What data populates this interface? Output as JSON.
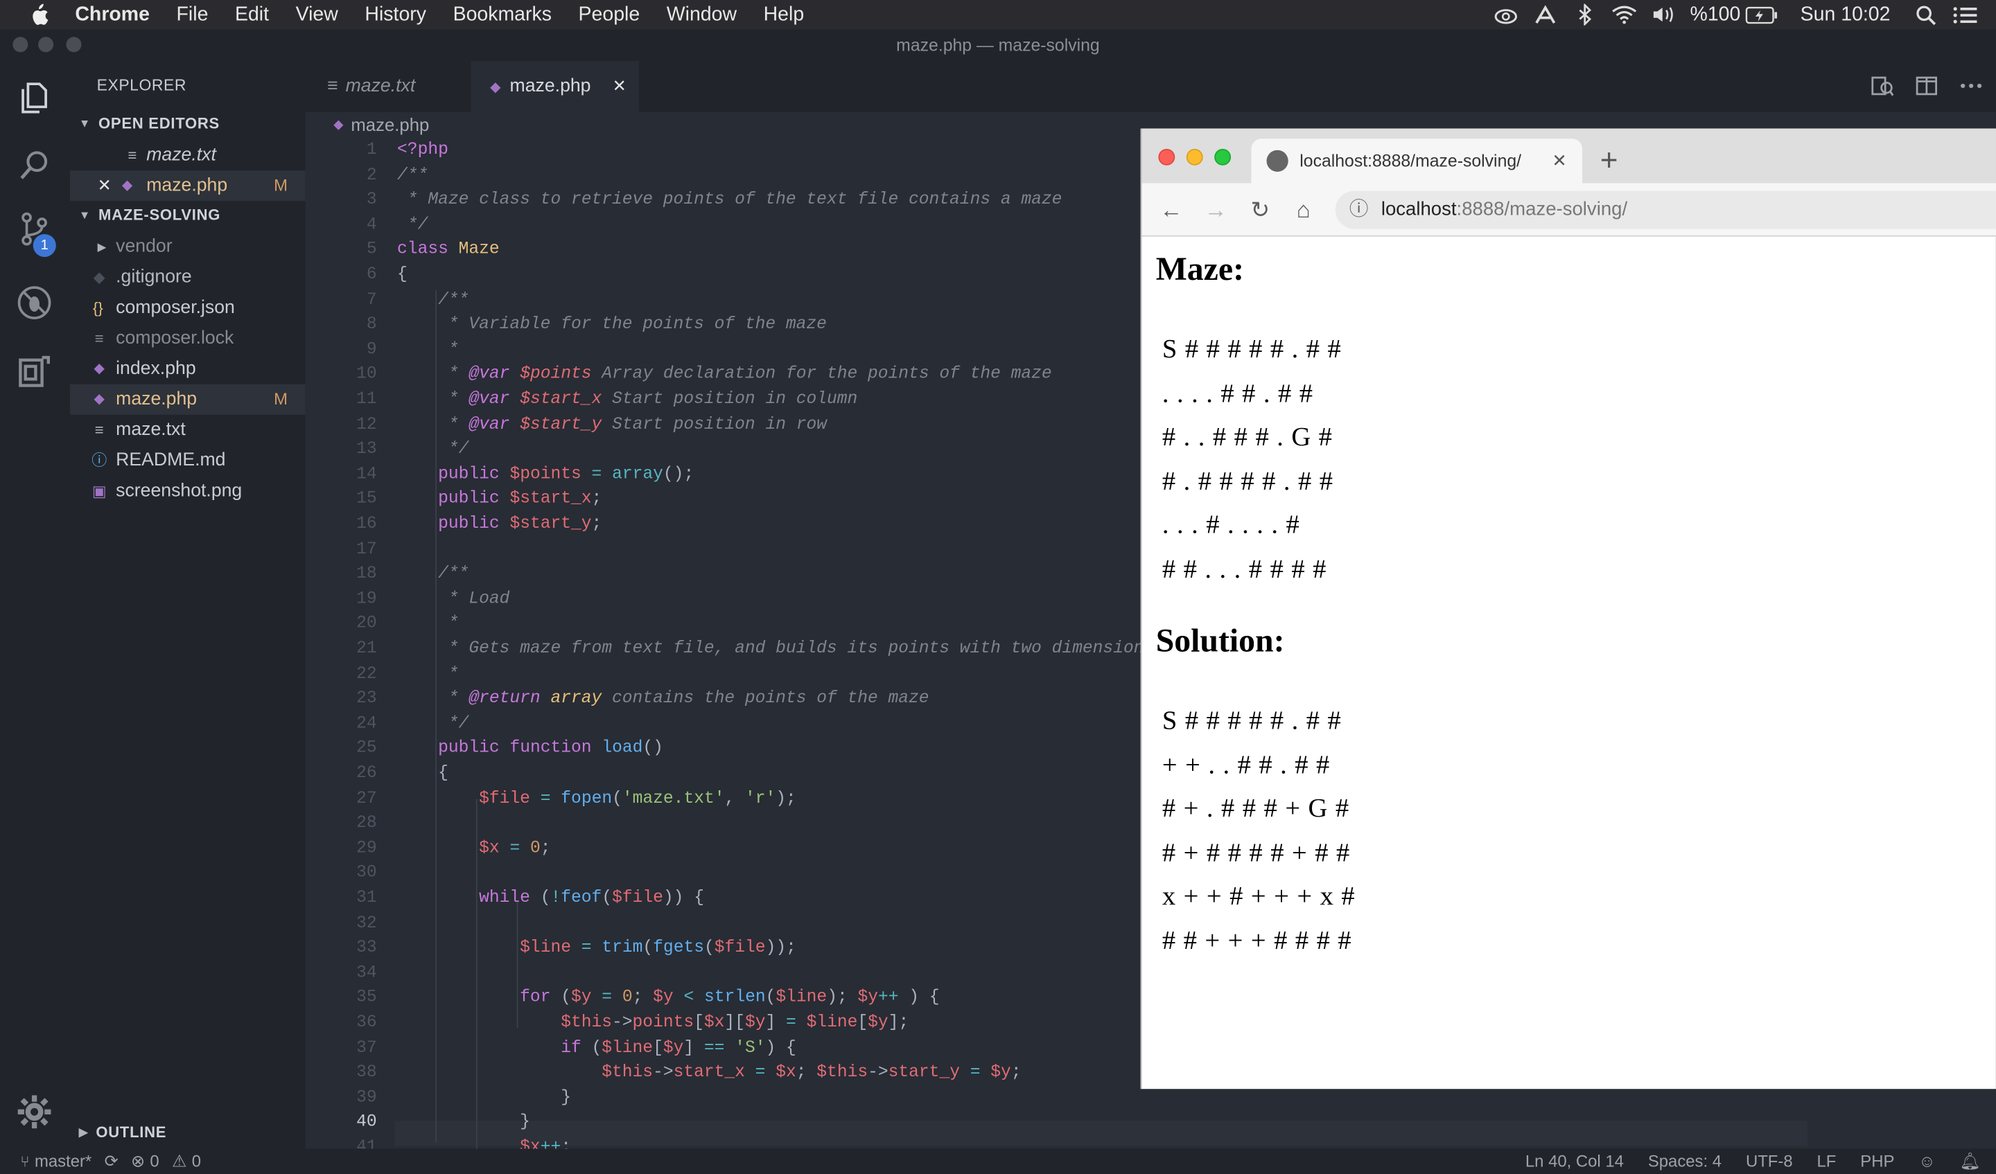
{
  "menubar": {
    "items": [
      "Chrome",
      "File",
      "Edit",
      "View",
      "History",
      "Bookmarks",
      "People",
      "Window",
      "Help"
    ],
    "battery": "%100",
    "clock": "Sun 10:02"
  },
  "window": {
    "title": "maze.php — maze-solving"
  },
  "activity": {
    "scm_badge": "1"
  },
  "sidebar": {
    "header": "EXPLORER",
    "open_editors_label": "OPEN EDITORS",
    "open_editors": [
      {
        "name": "maze.txt",
        "icon": "text-file-icon"
      },
      {
        "name": "maze.php",
        "icon": "php-file-icon",
        "status": "M"
      }
    ],
    "folder_label": "MAZE-SOLVING",
    "files": [
      {
        "name": "vendor",
        "icon": "folder-chevron-icon"
      },
      {
        "name": ".gitignore",
        "icon": "git-icon"
      },
      {
        "name": "composer.json",
        "icon": "json-icon"
      },
      {
        "name": "composer.lock",
        "icon": "text-file-icon"
      },
      {
        "name": "index.php",
        "icon": "php-file-icon"
      },
      {
        "name": "maze.php",
        "icon": "php-file-icon",
        "status": "M"
      },
      {
        "name": "maze.txt",
        "icon": "text-file-icon"
      },
      {
        "name": "README.md",
        "icon": "info-icon"
      },
      {
        "name": "screenshot.png",
        "icon": "image-icon"
      }
    ],
    "outline_label": "OUTLINE"
  },
  "tabs": [
    {
      "name": "maze.txt",
      "active": false
    },
    {
      "name": "maze.php",
      "active": true
    }
  ],
  "breadcrumb": "maze.php",
  "code_lines": [
    "<?php",
    "/**",
    " * Maze class to retrieve points of the text file contains a maze",
    " */",
    "class Maze",
    "{",
    "    /**",
    "     * Variable for the points of the maze",
    "     *",
    "     * @var $points Array declaration for the points of the maze",
    "     * @var $start_x Start position in column",
    "     * @var $start_y Start position in row",
    "     */",
    "    public $points = array();",
    "    public $start_x;",
    "    public $start_y;",
    "",
    "    /**",
    "     * Load",
    "     *",
    "     * Gets maze from text file, and builds its points with two dimensiona",
    "     *",
    "     * @return array contains the points of the maze",
    "     */",
    "    public function load()",
    "    {",
    "        $file = fopen('maze.txt', 'r');",
    "",
    "        $x = 0;",
    "",
    "        while (!feof($file)) {",
    "",
    "            $line = trim(fgets($file));",
    "",
    "            for ($y = 0; $y < strlen($line); $y++ ) {",
    "                $this->points[$x][$y] = $line[$y];",
    "                if ($line[$y] == 'S') {",
    "                    $this->start_x = $x; $this->start_y = $y;",
    "                }",
    "            }",
    "            $x++;"
  ],
  "status": {
    "branch": "master*",
    "errors": "0",
    "warnings": "0",
    "position": "Ln 40, Col 14",
    "spaces": "Spaces: 4",
    "encoding": "UTF-8",
    "eol": "LF",
    "language": "PHP"
  },
  "browser": {
    "tab_title": "localhost:8888/maze-solving/",
    "url_host": "localhost",
    "url_rest": ":8888/maze-solving/",
    "maze_heading": "Maze:",
    "maze_rows": [
      "S # # # # # . # #",
      ". . . . # # . # #",
      "# . . # # # . G #",
      "# . # # # # . # #",
      ". . . # . . . . #",
      "# # . . . # # # #"
    ],
    "solution_heading": "Solution:",
    "solution_rows": [
      "S # # # # # . # #",
      "+ + . . # # . # #",
      "# + . # # # + G #",
      "# + # # # # + # #",
      "x + + # + + + x #",
      "# # + + + # # # #"
    ]
  }
}
